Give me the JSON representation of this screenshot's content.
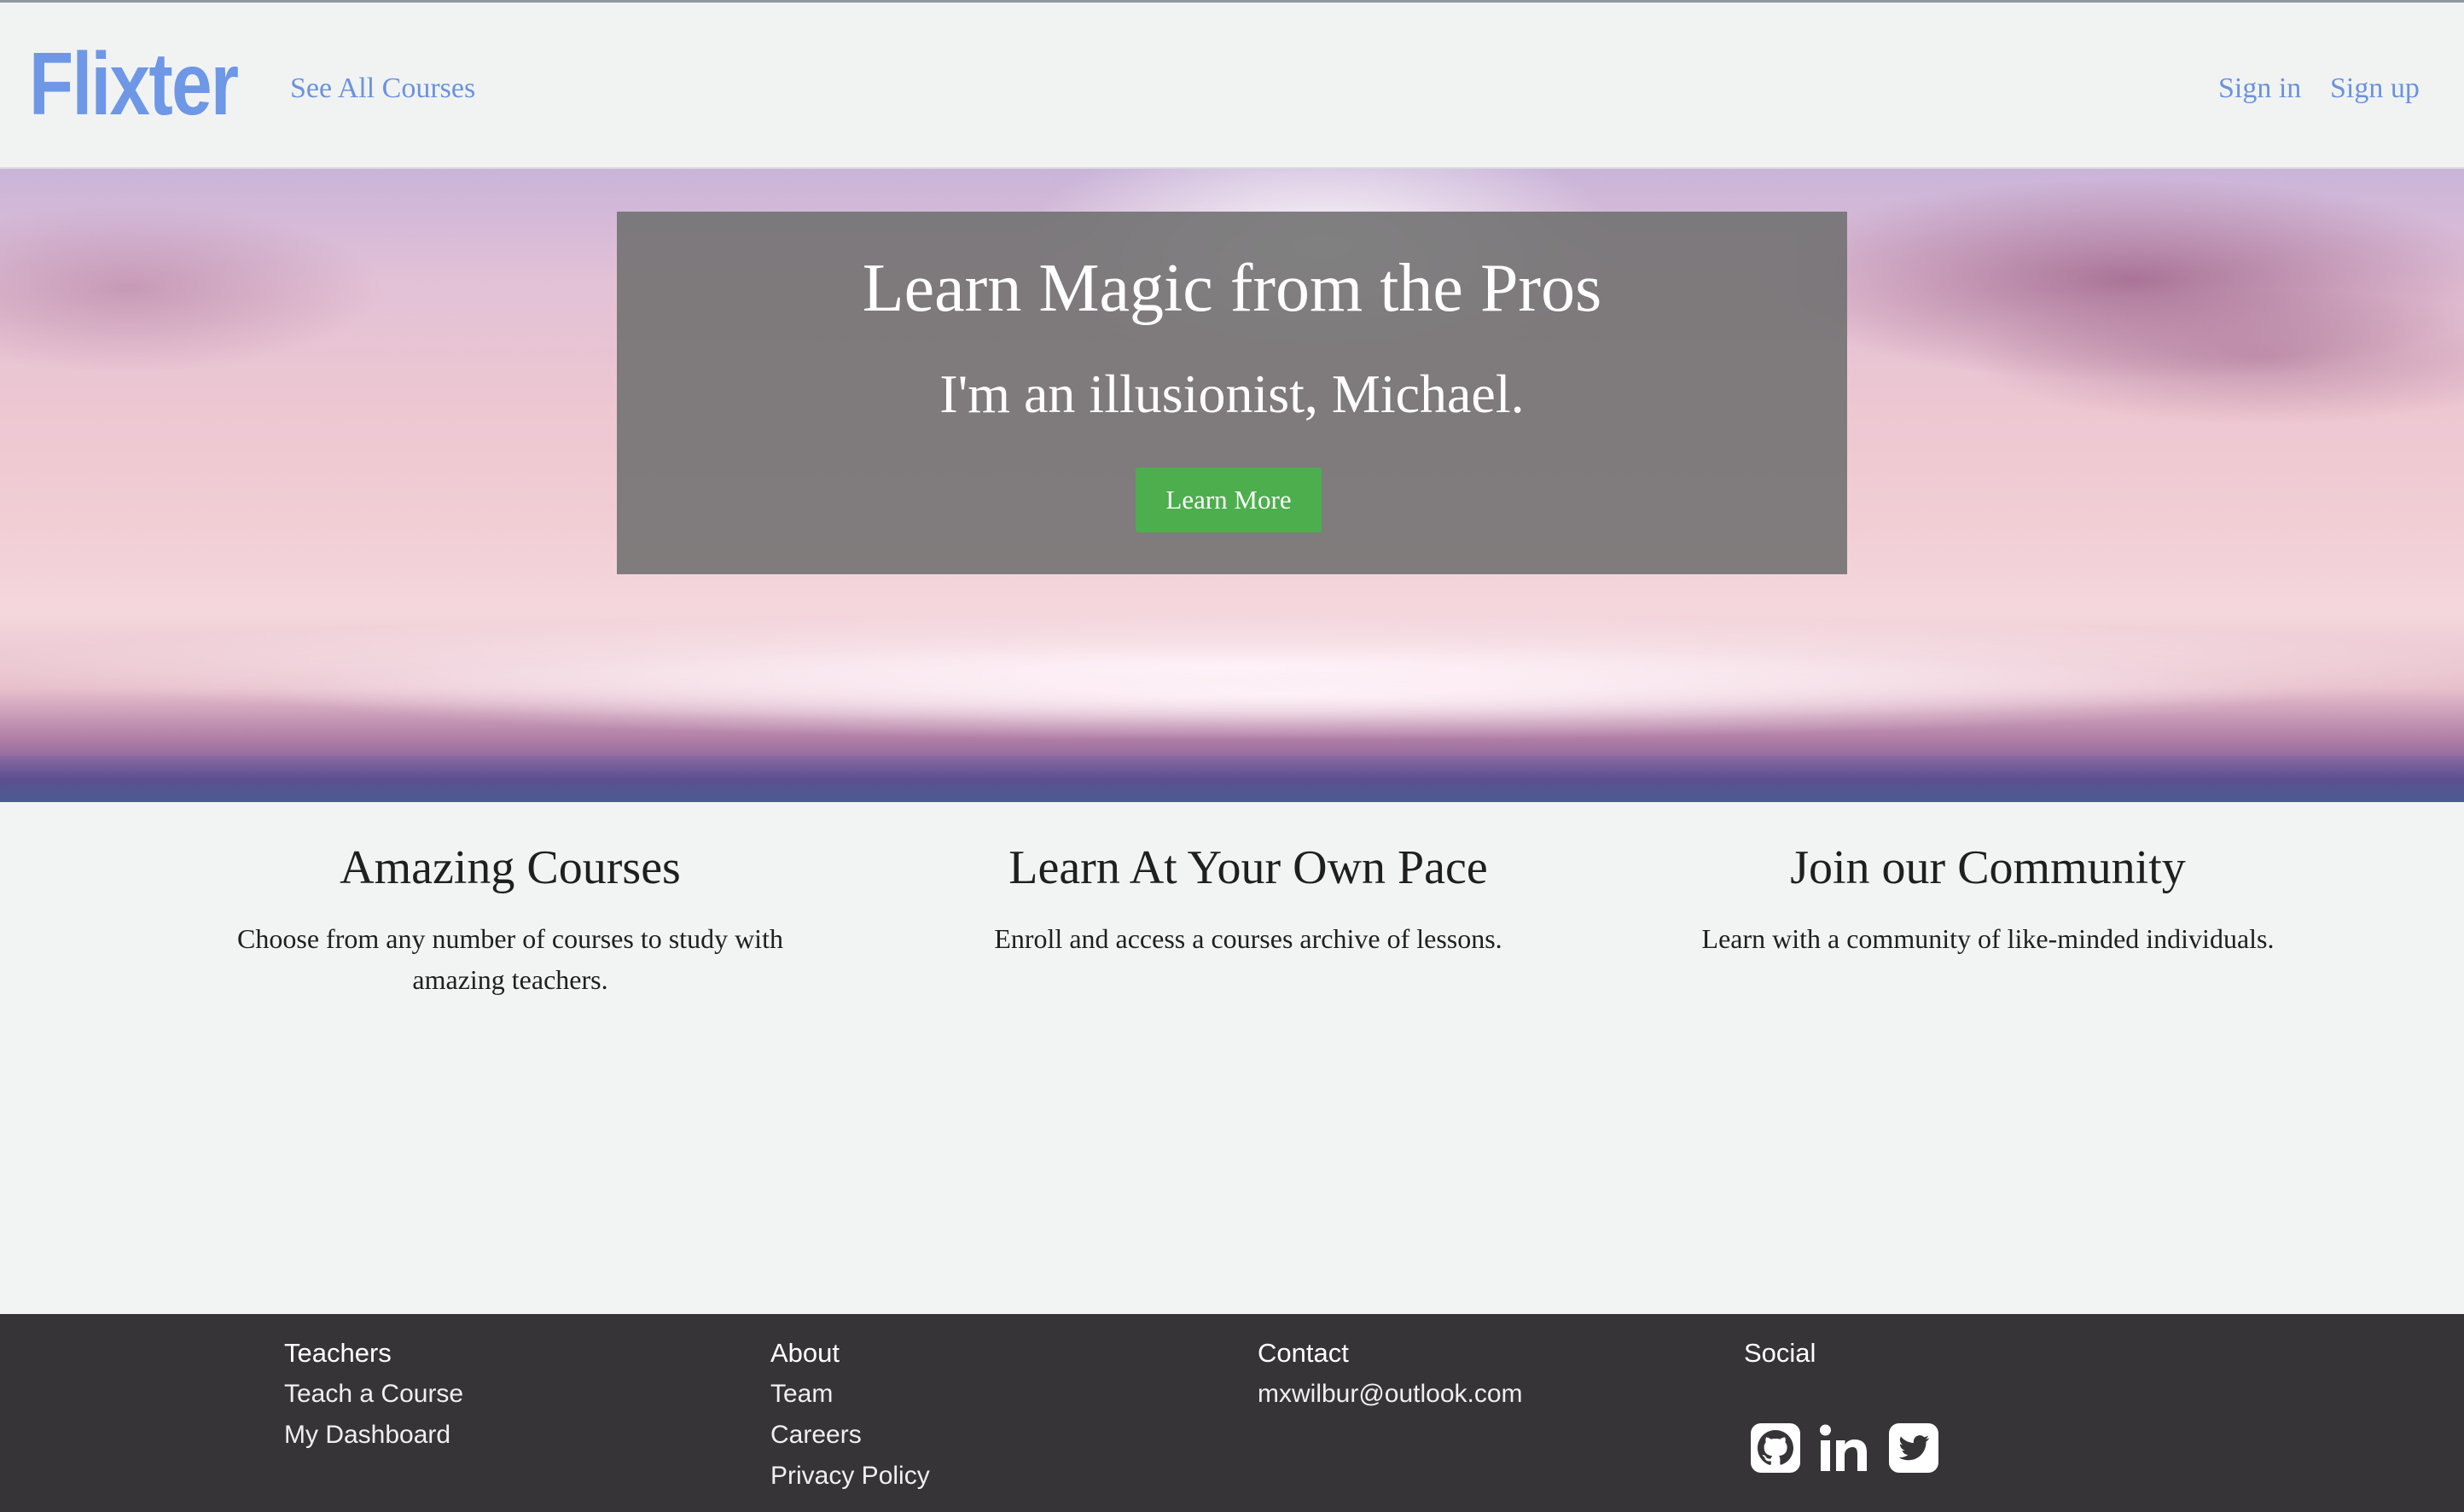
{
  "navbar": {
    "brand": "Flixter",
    "courses_link": "See All Courses",
    "signin": "Sign in",
    "signup": "Sign up"
  },
  "hero": {
    "title": "Learn Magic from the Pros",
    "subtitle": "I'm an illusionist, Michael.",
    "button": "Learn More",
    "button_color": "#4cae4c"
  },
  "features": [
    {
      "title": "Amazing Courses",
      "text": "Choose from any number of courses to study with amazing teachers."
    },
    {
      "title": "Learn At Your Own Pace",
      "text": "Enroll and access a courses archive of lessons."
    },
    {
      "title": "Join our Community",
      "text": "Learn with a community of like-minded individuals."
    }
  ],
  "footer": {
    "teachers": {
      "heading": "Teachers",
      "links": [
        "Teach a Course",
        "My Dashboard"
      ]
    },
    "about": {
      "heading": "About",
      "links": [
        "Team",
        "Careers",
        "Privacy Policy"
      ]
    },
    "contact": {
      "heading": "Contact",
      "email": "mxwilbur@outlook.com"
    },
    "social": {
      "heading": "Social",
      "icons": [
        "github-icon",
        "linkedin-icon",
        "twitter-icon"
      ]
    }
  },
  "colors": {
    "brand": "#6e97e6",
    "link": "#6b93db",
    "footer_bg": "#363436"
  }
}
